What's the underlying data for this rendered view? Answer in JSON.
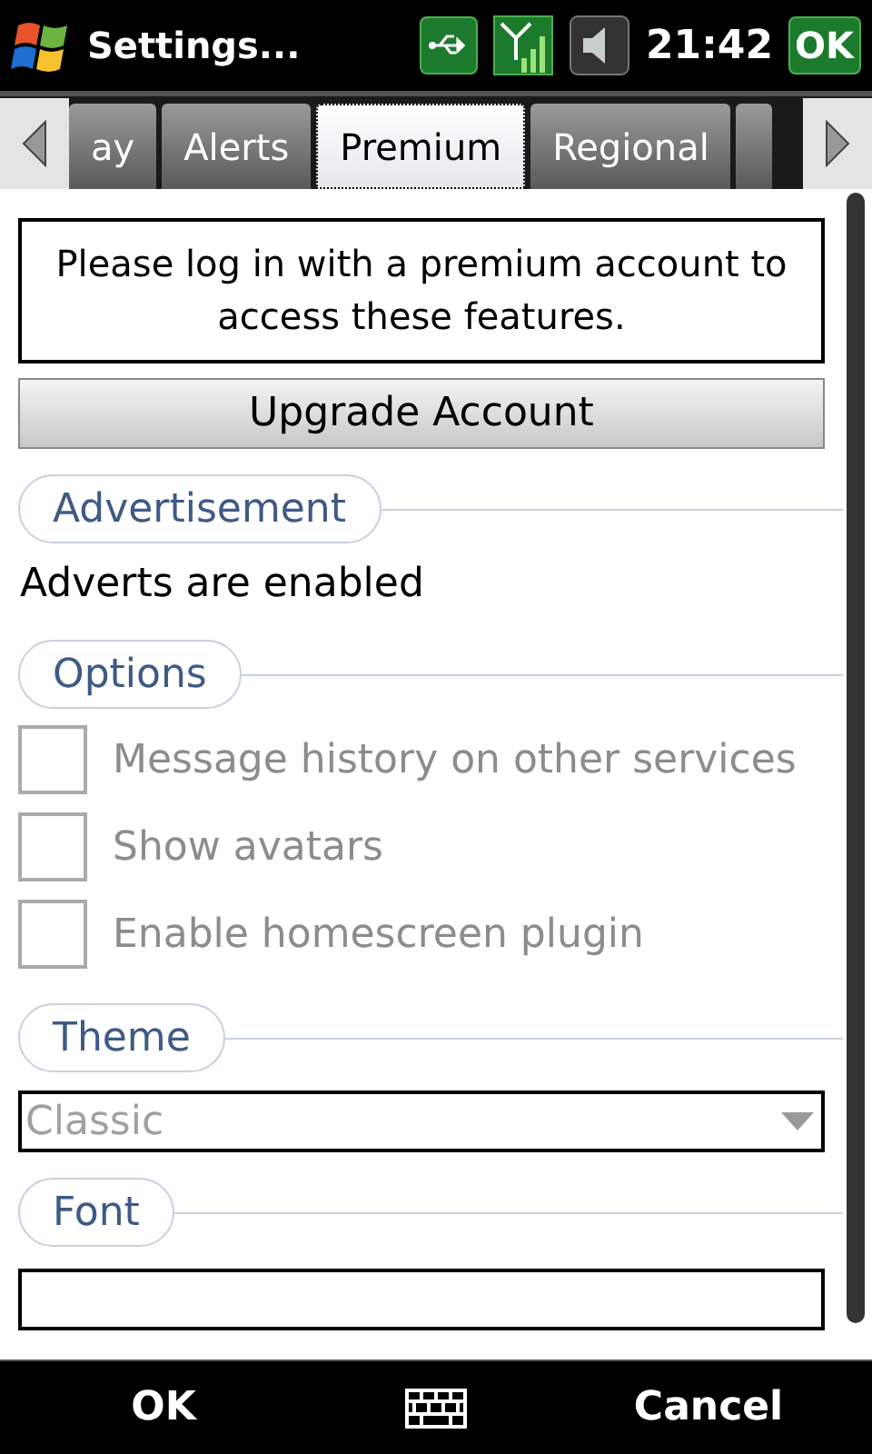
{
  "status_bar": {
    "title": "Settings...",
    "time": "21:42",
    "ok": "OK"
  },
  "tabs": [
    {
      "label": "ay",
      "selected": false
    },
    {
      "label": "Alerts",
      "selected": false
    },
    {
      "label": "Premium",
      "selected": true
    },
    {
      "label": "Regional",
      "selected": false
    }
  ],
  "notice": "Please log in with a premium account to access these features.",
  "upgrade_button": "Upgrade Account",
  "sections": [
    {
      "title": "Advertisement",
      "items": [
        {
          "kind": "text",
          "text": "Adverts are enabled"
        }
      ]
    },
    {
      "title": "Options",
      "items": [
        {
          "kind": "checkbox",
          "label": "Message history on other services",
          "checked": false,
          "disabled": true
        },
        {
          "kind": "checkbox",
          "label": "Show avatars",
          "checked": false,
          "disabled": true
        },
        {
          "kind": "checkbox",
          "label": "Enable homescreen plugin",
          "checked": false,
          "disabled": true
        }
      ]
    },
    {
      "title": "Theme",
      "items": [
        {
          "kind": "dropdown",
          "value": "Classic",
          "disabled": true
        }
      ]
    },
    {
      "title": "Font",
      "items": [
        {
          "kind": "field"
        }
      ]
    }
  ],
  "softkeys": {
    "left": "OK",
    "right": "Cancel"
  }
}
